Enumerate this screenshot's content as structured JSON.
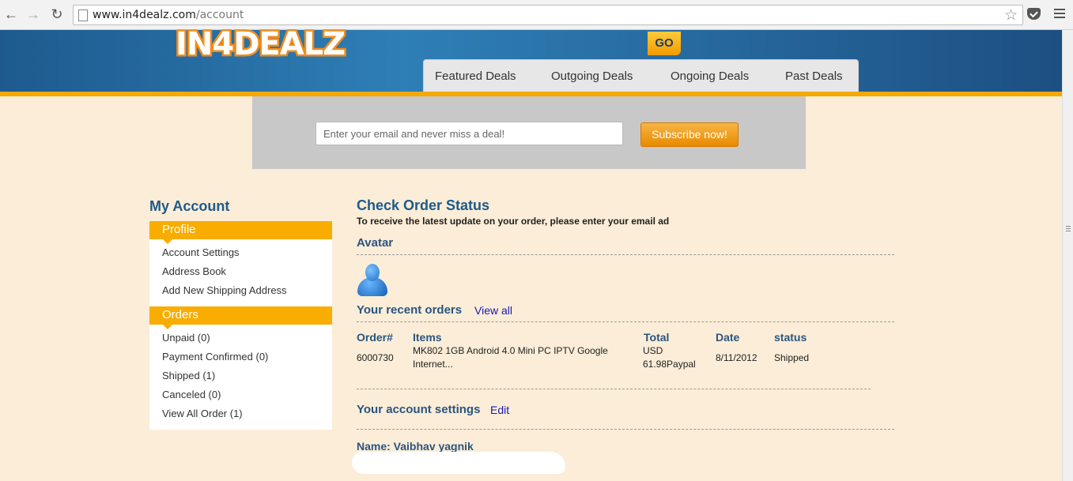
{
  "browser": {
    "url_host": "www.in4dealz.com",
    "url_path": "/account"
  },
  "header": {
    "logo_text": "IN4DEALZ",
    "go_label": "GO",
    "tabs": [
      {
        "label": "Featured Deals"
      },
      {
        "label": "Outgoing Deals"
      },
      {
        "label": "Ongoing Deals"
      },
      {
        "label": "Past Deals"
      }
    ]
  },
  "subscribe": {
    "placeholder": "Enter your email and never miss a deal!",
    "button_label": "Subscribe now!"
  },
  "sidebar": {
    "title": "My Account",
    "profile_heading": "Profile",
    "profile_items": [
      "Account Settings",
      "Address Book",
      "Add New Shipping Address"
    ],
    "orders_heading": "Orders",
    "order_items": [
      "Unpaid (0)",
      "Payment Confirmed (0)",
      "Shipped (1)",
      "Canceled (0)",
      "View All Order (1)"
    ]
  },
  "main": {
    "title": "Check Order Status",
    "subtitle": "To receive the latest update on your order, please enter your email ad",
    "avatar_label": "Avatar",
    "recent_orders_label": "Your recent orders",
    "view_all_link": "View all",
    "columns": [
      "Order#",
      "Items",
      "Total",
      "Date",
      "status"
    ],
    "order": {
      "number": "6000730",
      "items_line1": "MK802 1GB Android 4.0 Mini PC IPTV Google",
      "items_line2": "Internet...",
      "total_line1": "USD",
      "total_line2": "61.98Paypal",
      "date": "8/11/2012",
      "status": "Shipped"
    },
    "account_settings_label": "Your account settings",
    "edit_link": "Edit",
    "name_label": "Name: Vaibhav yagnik"
  }
}
